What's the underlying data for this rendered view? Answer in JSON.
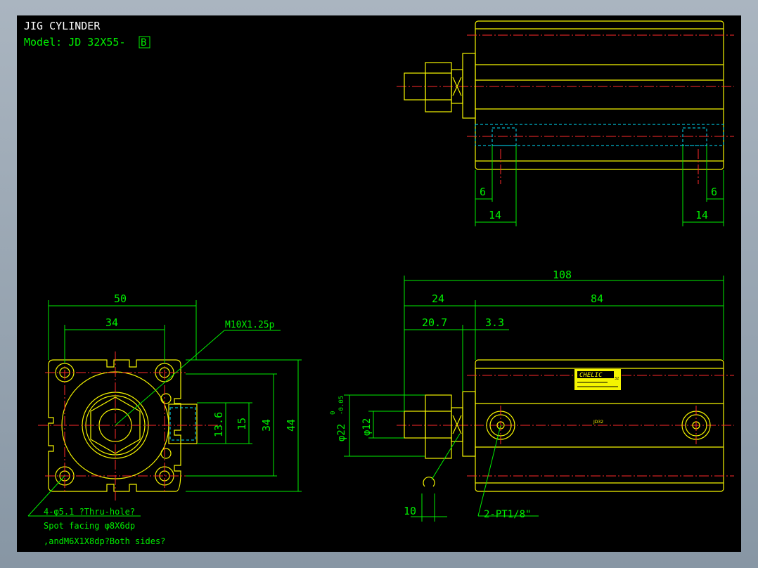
{
  "title": {
    "line1": "JIG CYLINDER",
    "line2_prefix": "Model: JD 32X55-",
    "line2_box": "B"
  },
  "top_view": {
    "dims": {
      "left_6": "6",
      "left_14": "14",
      "right_6": "6",
      "right_14": "14"
    }
  },
  "front_view": {
    "dims": {
      "d50": "50",
      "d34w": "34",
      "d13_6": "13.6",
      "d15": "15",
      "d34h": "34",
      "d44": "44"
    },
    "thread_callout": "M10X1.25p",
    "hole_note": [
      "4-φ5.1 ?Thru-hole?",
      "Spot facing φ8X6dp",
      ",andM6X1X8dp?Both sides?"
    ]
  },
  "side_view": {
    "dims": {
      "d108": "108",
      "d24": "24",
      "d84": "84",
      "d20_7": "20.7",
      "d3_3": "3.3",
      "d10": "10"
    },
    "phi22_label": "φ22",
    "phi22_tol_top": "0",
    "phi22_tol_bot": "-0.05",
    "phi12_label": "φ12",
    "port_label": "2-PT1/8\"",
    "brand_plate": "CHELIC",
    "plate_small": "32",
    "body_label": "JD32"
  }
}
